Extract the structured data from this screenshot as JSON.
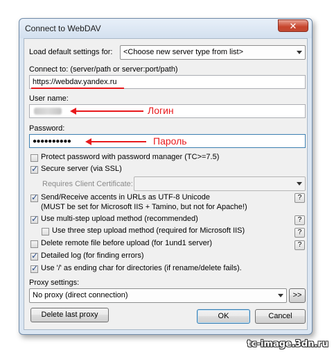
{
  "window": {
    "title": "Connect to WebDAV",
    "close_label": "✕"
  },
  "load_defaults": {
    "label": "Load default settings for:",
    "value": "<Choose new server type from list>"
  },
  "connect_to": {
    "label": "Connect to: (server/path or server:port/path)",
    "value": "https://webdav.yandex.ru"
  },
  "user_name": {
    "label": "User name:",
    "annotation": "Логин"
  },
  "password": {
    "label": "Password:",
    "value": "●●●●●●●●●●",
    "annotation": "Пароль"
  },
  "options": {
    "protect_password": {
      "label": "Protect password with password manager (TC>=7.5)",
      "checked": false
    },
    "secure_server": {
      "label": "Secure server (via SSL)",
      "checked": true
    },
    "client_cert_label": "Requires Client Certificate:",
    "utf8": {
      "label": "Send/Receive accents in URLs as UTF-8 Unicode",
      "note": "(MUST be set for Microsoft IIS + Tamino, but not for Apache!)",
      "checked": true
    },
    "multistep": {
      "label": "Use multi-step upload method (recommended)",
      "checked": true
    },
    "threestep": {
      "label": "Use three step upload method (required for Microsoft IIS)",
      "checked": false
    },
    "delete_before": {
      "label": "Delete remote file before upload (for 1und1 server)",
      "checked": false
    },
    "detailed_log": {
      "label": "Detailed log (for finding errors)",
      "checked": true
    },
    "slash_dirs": {
      "label": "Use '/' as ending char for directories (if rename/delete fails).",
      "checked": true
    }
  },
  "help_label": "?",
  "proxy": {
    "label": "Proxy settings:",
    "value": "No proxy (direct connection)",
    "more_label": ">>"
  },
  "buttons": {
    "delete_proxy": "Delete last proxy",
    "ok": "OK",
    "cancel": "Cancel"
  },
  "watermark": "tc-image.3dn.ru",
  "colors": {
    "annotation": "#e8191c",
    "window_frame": "#dbe6f2"
  }
}
